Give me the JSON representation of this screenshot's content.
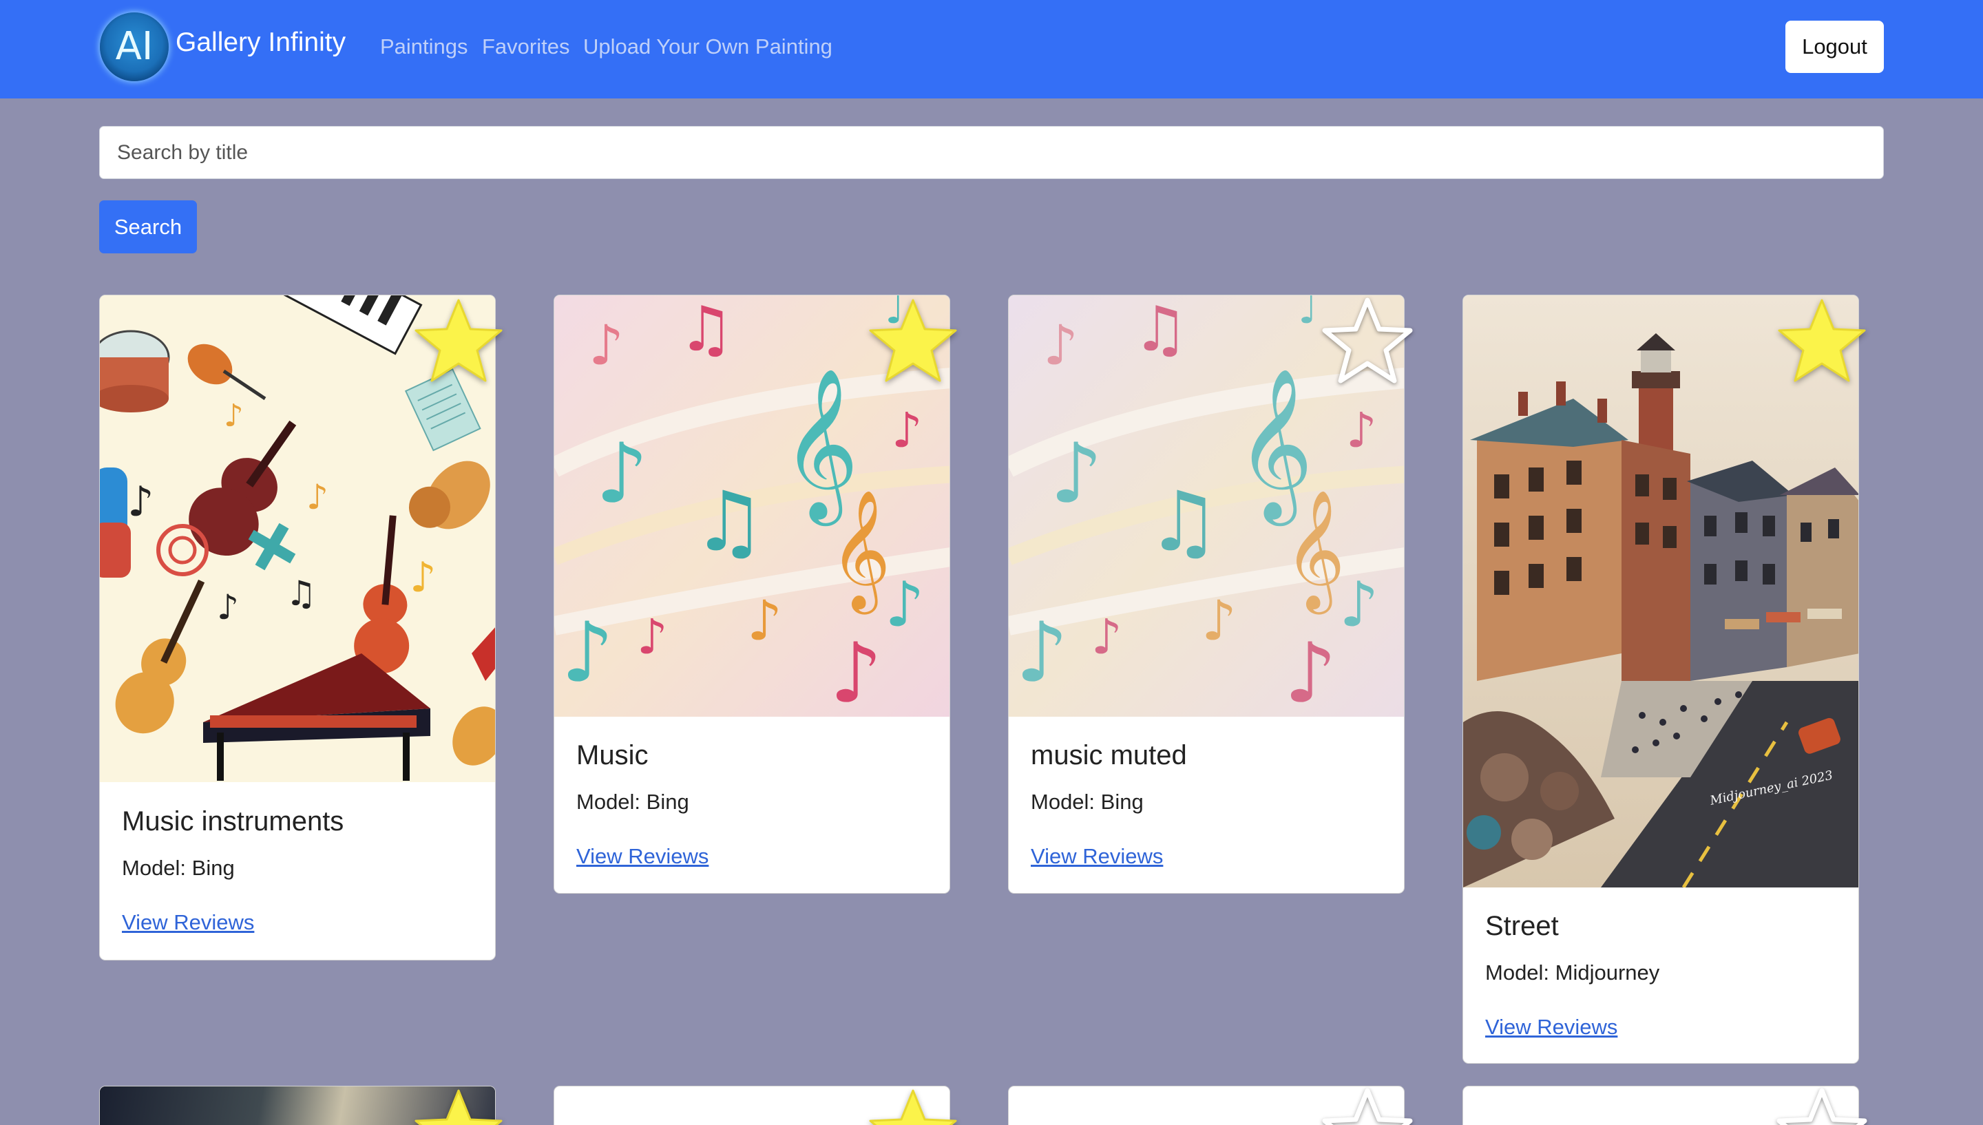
{
  "nav": {
    "logo_text": "AI",
    "brand": "Gallery Infinity",
    "links": [
      "Paintings",
      "Favorites",
      "Upload Your Own Painting"
    ],
    "logout_label": "Logout"
  },
  "search": {
    "placeholder": "Search by title",
    "button_label": "Search"
  },
  "colors": {
    "nav_bg": "#346ff6",
    "page_bg": "#8e8fae",
    "star_filled": "#fbf34a",
    "link": "#2f64d8"
  },
  "paintings": [
    {
      "title": "Music instruments",
      "model": "Model: Bing",
      "link": "View Reviews",
      "favorite": true,
      "image_icon": "music-instruments-image"
    },
    {
      "title": "Music",
      "model": "Model: Bing",
      "link": "View Reviews",
      "favorite": true,
      "image_icon": "music-notes-image"
    },
    {
      "title": "music muted",
      "model": "Model: Bing",
      "link": "View Reviews",
      "favorite": false,
      "image_icon": "music-notes-muted-image"
    },
    {
      "title": "Street",
      "model": "Model: Midjourney",
      "link": "View Reviews",
      "favorite": true,
      "image_icon": "street-image",
      "signature": "Midjourney_ai 2023"
    }
  ],
  "second_row_favorites": [
    true,
    true,
    false,
    false
  ]
}
